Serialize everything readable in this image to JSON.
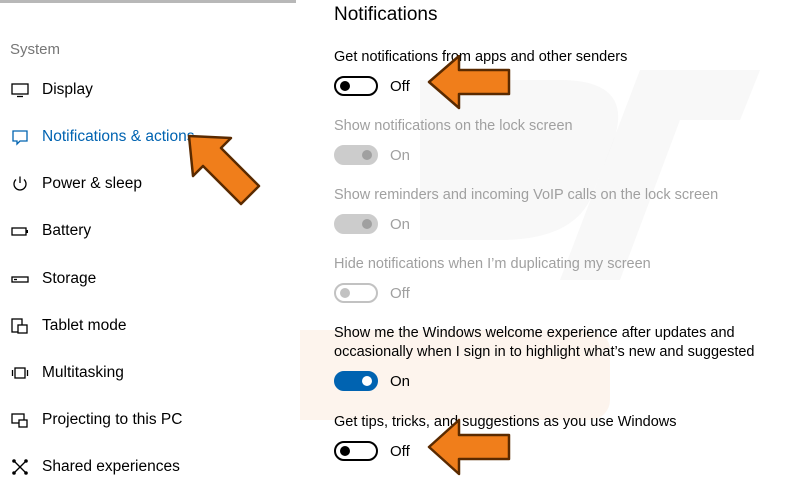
{
  "sidebar": {
    "section_label": "System",
    "items": [
      {
        "label": "Display",
        "icon": "monitor-icon",
        "active": false
      },
      {
        "label": "Notifications & actions",
        "icon": "notification-icon",
        "active": true
      },
      {
        "label": "Power & sleep",
        "icon": "power-icon",
        "active": false
      },
      {
        "label": "Battery",
        "icon": "battery-icon",
        "active": false
      },
      {
        "label": "Storage",
        "icon": "storage-icon",
        "active": false
      },
      {
        "label": "Tablet mode",
        "icon": "tablet-mode-icon",
        "active": false
      },
      {
        "label": "Multitasking",
        "icon": "multitasking-icon",
        "active": false
      },
      {
        "label": "Projecting to this PC",
        "icon": "projecting-icon",
        "active": false
      },
      {
        "label": "Shared experiences",
        "icon": "shared-experiences-icon",
        "active": false
      }
    ]
  },
  "main": {
    "title": "Notifications",
    "settings": [
      {
        "desc": "Get notifications from apps and other senders",
        "state": "Off",
        "enabled": true
      },
      {
        "desc": "Show notifications on the lock screen",
        "state": "On",
        "enabled": false
      },
      {
        "desc": "Show reminders and incoming VoIP calls on the lock screen",
        "state": "On",
        "enabled": false
      },
      {
        "desc": "Hide notifications when I’m duplicating my screen",
        "state": "Off",
        "enabled": false
      },
      {
        "desc": "Show me the Windows welcome experience after updates and occasionally when I sign in to highlight what’s new and suggested",
        "state": "On",
        "enabled": true
      },
      {
        "desc": "Get tips, tricks, and suggestions as you use Windows",
        "state": "Off",
        "enabled": true
      }
    ]
  },
  "colors": {
    "accent": "#0063b1",
    "disabled": "#a0a0a0",
    "annotation_arrow": "#f07e1b"
  }
}
